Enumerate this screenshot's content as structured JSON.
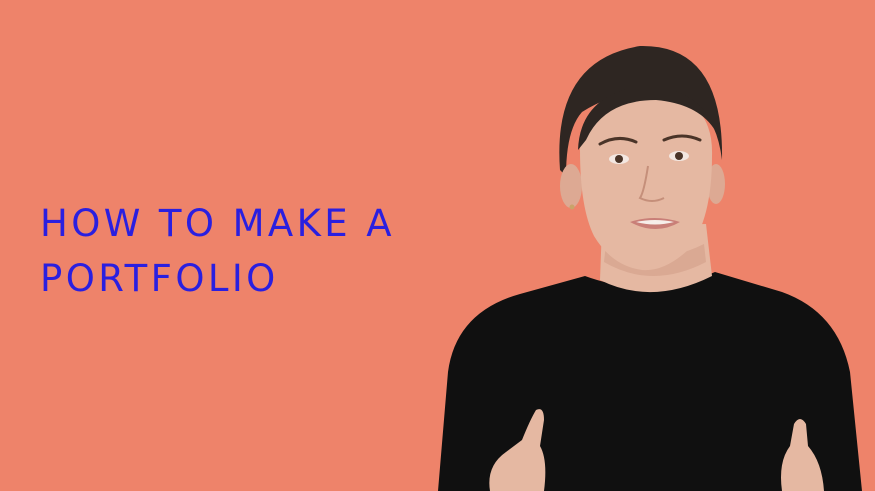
{
  "title": {
    "line1": "HOW TO MAKE A",
    "line2": "PORTFOLIO"
  },
  "colors": {
    "background": "#EE836A",
    "title_text": "#2A1FE0",
    "sweater": "#101010",
    "hair": "#2E2622",
    "skin": "#E5B8A2",
    "skin_shadow": "#D29E88",
    "lips": "#C97F78",
    "eyes": "#4A3428"
  }
}
